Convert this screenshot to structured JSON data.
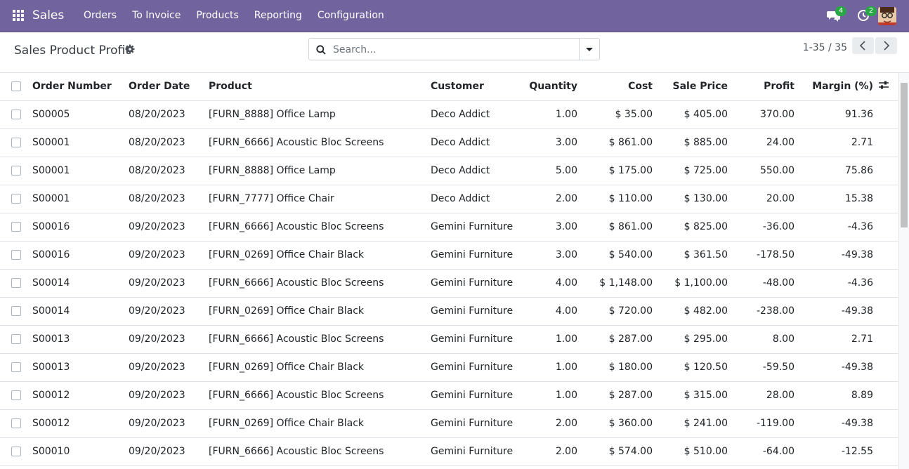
{
  "navbar": {
    "brand": "Sales",
    "menu": [
      "Orders",
      "To Invoice",
      "Products",
      "Reporting",
      "Configuration"
    ],
    "messages_count": "4",
    "activities_count": "2"
  },
  "control": {
    "title": "Sales Product Profit",
    "search_placeholder": "Search...",
    "pager": "1-35 / 35"
  },
  "table": {
    "headers": {
      "order_number": "Order Number",
      "order_date": "Order Date",
      "product": "Product",
      "customer": "Customer",
      "quantity": "Quantity",
      "cost": "Cost",
      "sale_price": "Sale Price",
      "profit": "Profit",
      "margin": "Margin (%)"
    },
    "rows": [
      [
        "S00005",
        "08/20/2023",
        "[FURN_8888] Office Lamp",
        "Deco Addict",
        "1.00",
        "$ 35.00",
        "$ 405.00",
        "370.00",
        "91.36"
      ],
      [
        "S00001",
        "08/20/2023",
        "[FURN_6666] Acoustic Bloc Screens",
        "Deco Addict",
        "3.00",
        "$ 861.00",
        "$ 885.00",
        "24.00",
        "2.71"
      ],
      [
        "S00001",
        "08/20/2023",
        "[FURN_8888] Office Lamp",
        "Deco Addict",
        "5.00",
        "$ 175.00",
        "$ 725.00",
        "550.00",
        "75.86"
      ],
      [
        "S00001",
        "08/20/2023",
        "[FURN_7777] Office Chair",
        "Deco Addict",
        "2.00",
        "$ 110.00",
        "$ 130.00",
        "20.00",
        "15.38"
      ],
      [
        "S00016",
        "09/20/2023",
        "[FURN_6666] Acoustic Bloc Screens",
        "Gemini Furniture",
        "3.00",
        "$ 861.00",
        "$ 825.00",
        "-36.00",
        "-4.36"
      ],
      [
        "S00016",
        "09/20/2023",
        "[FURN_0269] Office Chair Black",
        "Gemini Furniture",
        "3.00",
        "$ 540.00",
        "$ 361.50",
        "-178.50",
        "-49.38"
      ],
      [
        "S00014",
        "09/20/2023",
        "[FURN_6666] Acoustic Bloc Screens",
        "Gemini Furniture",
        "4.00",
        "$ 1,148.00",
        "$ 1,100.00",
        "-48.00",
        "-4.36"
      ],
      [
        "S00014",
        "09/20/2023",
        "[FURN_0269] Office Chair Black",
        "Gemini Furniture",
        "4.00",
        "$ 720.00",
        "$ 482.00",
        "-238.00",
        "-49.38"
      ],
      [
        "S00013",
        "09/20/2023",
        "[FURN_6666] Acoustic Bloc Screens",
        "Gemini Furniture",
        "1.00",
        "$ 287.00",
        "$ 295.00",
        "8.00",
        "2.71"
      ],
      [
        "S00013",
        "09/20/2023",
        "[FURN_0269] Office Chair Black",
        "Gemini Furniture",
        "1.00",
        "$ 180.00",
        "$ 120.50",
        "-59.50",
        "-49.38"
      ],
      [
        "S00012",
        "09/20/2023",
        "[FURN_6666] Acoustic Bloc Screens",
        "Gemini Furniture",
        "1.00",
        "$ 287.00",
        "$ 315.00",
        "28.00",
        "8.89"
      ],
      [
        "S00012",
        "09/20/2023",
        "[FURN_0269] Office Chair Black",
        "Gemini Furniture",
        "2.00",
        "$ 360.00",
        "$ 241.00",
        "-119.00",
        "-49.38"
      ],
      [
        "S00010",
        "09/20/2023",
        "[FURN_6666] Acoustic Bloc Screens",
        "Gemini Furniture",
        "2.00",
        "$ 574.00",
        "$ 510.00",
        "-64.00",
        "-12.55"
      ]
    ]
  },
  "colors": {
    "navbar": "#71639e",
    "badge": "#28a745"
  }
}
